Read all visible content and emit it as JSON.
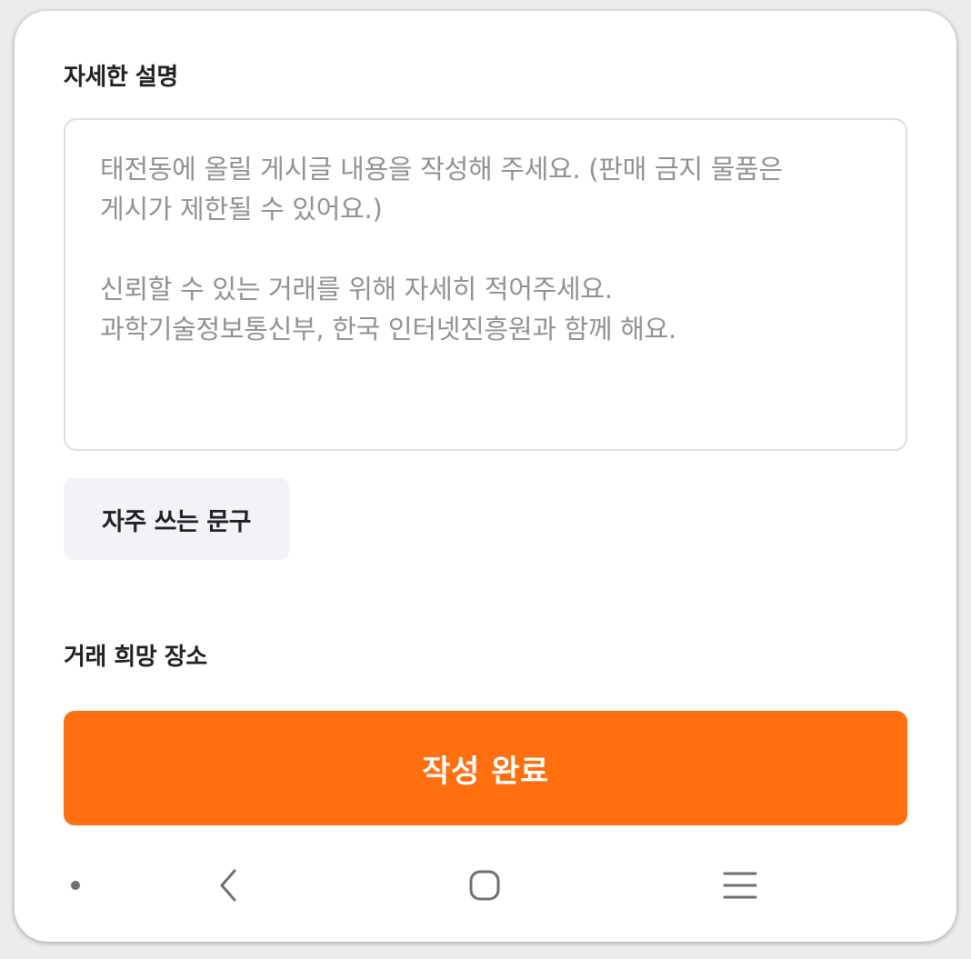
{
  "form": {
    "description_label": "자세한 설명",
    "description_placeholder_lines": [
      "태전동에 올릴 게시글 내용을 작성해 주세요. (판매 금지 물품은",
      "게시가 제한될 수 있어요.)",
      "",
      "신뢰할 수 있는 거래를 위해 자세히 적어주세요.",
      "과학기술정보통신부, 한국 인터넷진흥원과 함께 해요."
    ],
    "frequent_phrases_button": "자주 쓰는 문구",
    "place_label": "거래 희망 장소",
    "submit_button": "작성 완료"
  },
  "navbar": {
    "icons": [
      "dot-indicator-icon",
      "back-icon",
      "home-icon",
      "recent-apps-icon"
    ]
  },
  "colors": {
    "accent": "#ff6f0f",
    "placeholder_text": "#8f9296",
    "label_text": "#212124",
    "secondary_button_bg": "#f2f3f6",
    "input_border": "#dcdee3"
  }
}
